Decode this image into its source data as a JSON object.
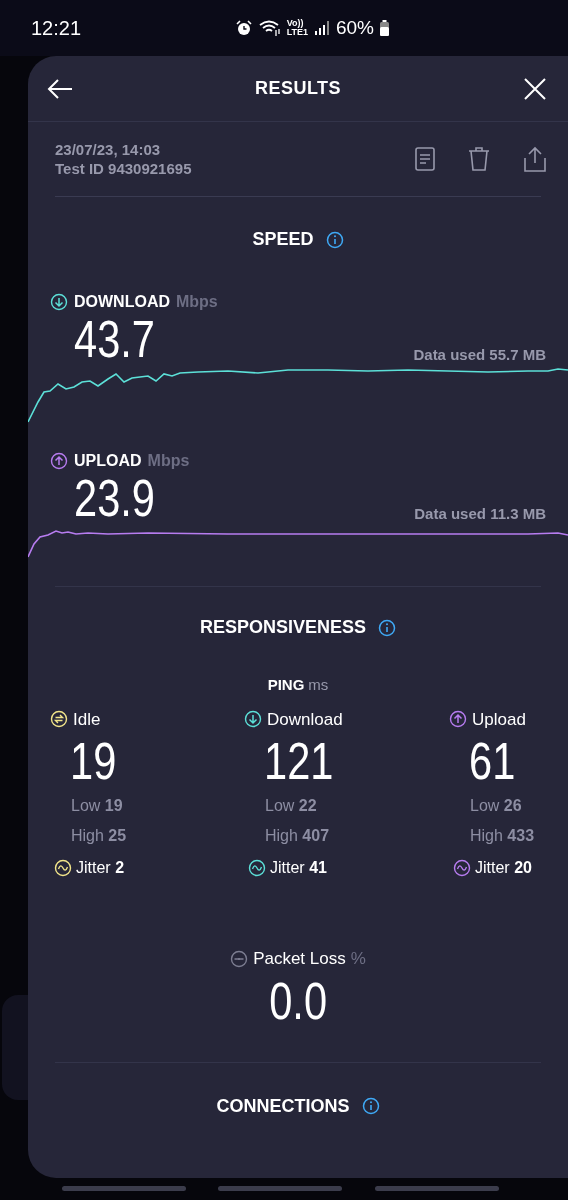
{
  "status_bar": {
    "time": "12:21",
    "volte": "Vo))",
    "network": "LTE1",
    "battery": "60%"
  },
  "header": {
    "title": "RESULTS"
  },
  "test": {
    "date": "23/07/23, 14:03",
    "test_id": "Test ID 9430921695"
  },
  "speed": {
    "title": "SPEED",
    "metrics": [
      {
        "kind": "download",
        "label": "DOWNLOAD",
        "unit": "Mbps",
        "value": "43.7",
        "data_used": "Data used 55.7 MB",
        "color": "#5ce0d8"
      },
      {
        "kind": "upload",
        "label": "UPLOAD",
        "unit": "Mbps",
        "value": "23.9",
        "data_used": "Data used 11.3 MB",
        "color": "#b77cf0"
      }
    ]
  },
  "responsiveness": {
    "title": "RESPONSIVENESS",
    "ping_label": "PING",
    "ping_unit": "ms",
    "columns": [
      {
        "kind": "idle",
        "label": "Idle",
        "value": "19",
        "low_label": "Low",
        "low": "19",
        "high_label": "High",
        "high": "25",
        "jitter_label": "Jitter",
        "jitter": "2",
        "color": "#f2e58a"
      },
      {
        "kind": "download",
        "label": "Download",
        "value": "121",
        "low_label": "Low",
        "low": "22",
        "high_label": "High",
        "high": "407",
        "jitter_label": "Jitter",
        "jitter": "41",
        "color": "#5ce0d8"
      },
      {
        "kind": "upload",
        "label": "Upload",
        "value": "61",
        "low_label": "Low",
        "low": "26",
        "high_label": "High",
        "high": "433",
        "jitter_label": "Jitter",
        "jitter": "20",
        "color": "#b77cf0"
      }
    ],
    "packet_loss": {
      "label": "Packet Loss",
      "unit": "%",
      "value": "0.0"
    }
  },
  "connections": {
    "title": "CONNECTIONS"
  }
}
